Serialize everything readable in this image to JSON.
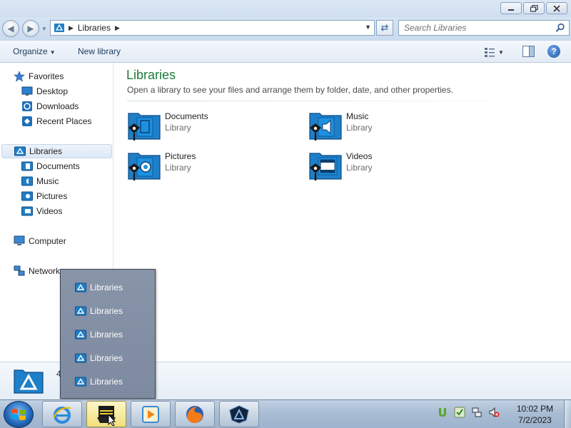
{
  "window": {
    "title_buttons": [
      "minimize-icon",
      "maximize-icon",
      "close-icon"
    ]
  },
  "address_bar": {
    "crumb": "Libraries",
    "search_placeholder": "Search Libraries"
  },
  "toolbar": {
    "organize_label": "Organize",
    "new_library_label": "New library"
  },
  "nav": {
    "favorites_label": "Favorites",
    "favorites": [
      "Desktop",
      "Downloads",
      "Recent Places"
    ],
    "libraries_label": "Libraries",
    "libraries": [
      "Documents",
      "Music",
      "Pictures",
      "Videos"
    ],
    "computer_label": "Computer",
    "network_label": "Network"
  },
  "content": {
    "title": "Libraries",
    "subtitle": "Open a library to see your files and arrange them by folder, date, and other properties.",
    "libraries": [
      {
        "name": "Documents",
        "type": "Library"
      },
      {
        "name": "Music",
        "type": "Library"
      },
      {
        "name": "Pictures",
        "type": "Library"
      },
      {
        "name": "Videos",
        "type": "Library"
      }
    ]
  },
  "details": {
    "count_text": "4"
  },
  "jumplist": {
    "items": [
      "Libraries",
      "Libraries",
      "Libraries",
      "Libraries",
      "Libraries"
    ]
  },
  "taskbar": {
    "time": "10:02 PM",
    "date": "7/2/2023"
  },
  "colors": {
    "title_green": "#1e7a3a",
    "folder_blue": "#1f7fc8",
    "jumplist_bg": "#7f8ca2"
  }
}
